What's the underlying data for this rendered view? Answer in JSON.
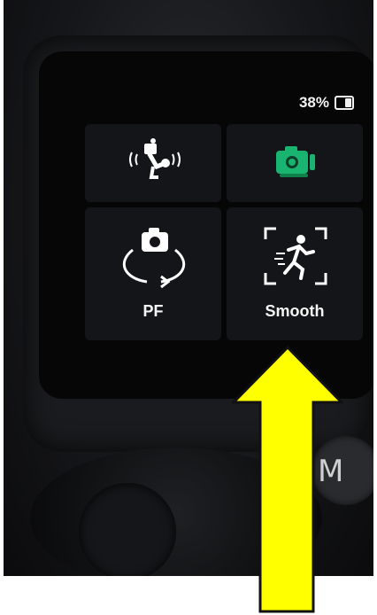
{
  "status": {
    "battery_text": "38%"
  },
  "tiles": [
    {
      "name": "gimbal-mode",
      "label": ""
    },
    {
      "name": "camera-mode",
      "label": ""
    },
    {
      "name": "pf-mode",
      "label": "PF"
    },
    {
      "name": "smooth-mode",
      "label": "Smooth"
    }
  ],
  "hardware": {
    "m_button_label": "M"
  },
  "colors": {
    "accent": "#19b46f",
    "annotation_arrow": "#ffff00"
  }
}
